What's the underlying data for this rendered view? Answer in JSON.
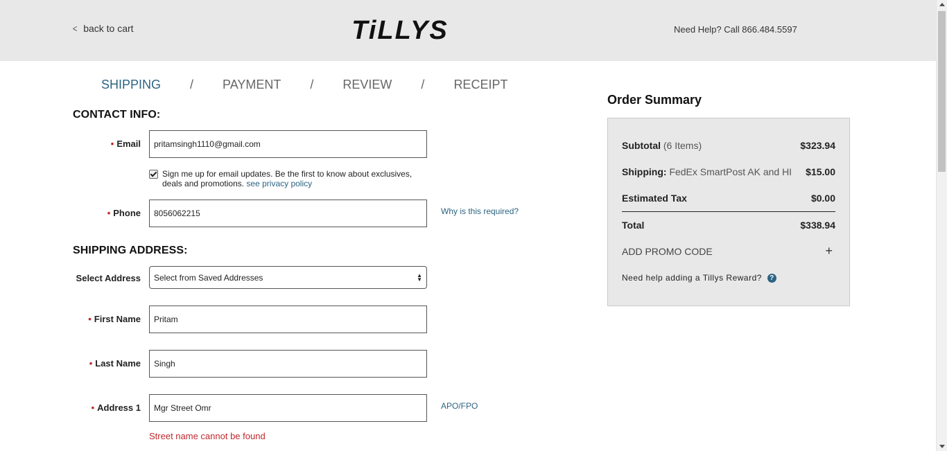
{
  "header": {
    "back_label": "back to cart",
    "brand": "TiLLYS",
    "help_text": "Need Help? Call 866.484.5597"
  },
  "steps": [
    {
      "label": "SHIPPING",
      "active": true
    },
    {
      "label": "PAYMENT",
      "active": false
    },
    {
      "label": "REVIEW",
      "active": false
    },
    {
      "label": "RECEIPT",
      "active": false
    }
  ],
  "step_separator": "/",
  "contact": {
    "title": "CONTACT INFO:",
    "email_label": "Email",
    "email_value": "pritamsingh1110@gmail.com",
    "signup_text": "Sign me up for email updates. Be the first to know about exclusives, deals and promotions.",
    "privacy_link": "see privacy policy",
    "signup_checked": true,
    "phone_label": "Phone",
    "phone_value": "8056062215",
    "why_link": "Why is this required?"
  },
  "shipping": {
    "title": "SHIPPING ADDRESS:",
    "select_label": "Select Address",
    "select_value": "Select from Saved Addresses",
    "first_name_label": "First Name",
    "first_name_value": "Pritam",
    "last_name_label": "Last Name",
    "last_name_value": "Singh",
    "address1_label": "Address 1",
    "address1_value": "Mgr Street Omr",
    "apo_link": "APO/FPO",
    "address_error": "Street name cannot be found"
  },
  "required_marker": "•",
  "summary": {
    "title": "Order Summary",
    "subtotal_label": "Subtotal",
    "subtotal_items": "(6 Items)",
    "subtotal_value": "$323.94",
    "shipping_label": "Shipping:",
    "shipping_method": "FedEx SmartPost AK and HI",
    "shipping_value": "$15.00",
    "tax_label": "Estimated Tax",
    "tax_value": "$0.00",
    "total_label": "Total",
    "total_value": "$338.94",
    "promo_label": "ADD PROMO CODE",
    "promo_icon": "+",
    "reward_text": "Need help adding a Tillys Reward?",
    "reward_icon": "?"
  },
  "colors": {
    "accent": "#2c6482",
    "error": "#c0282d",
    "header_bg": "#e9e8e9"
  }
}
